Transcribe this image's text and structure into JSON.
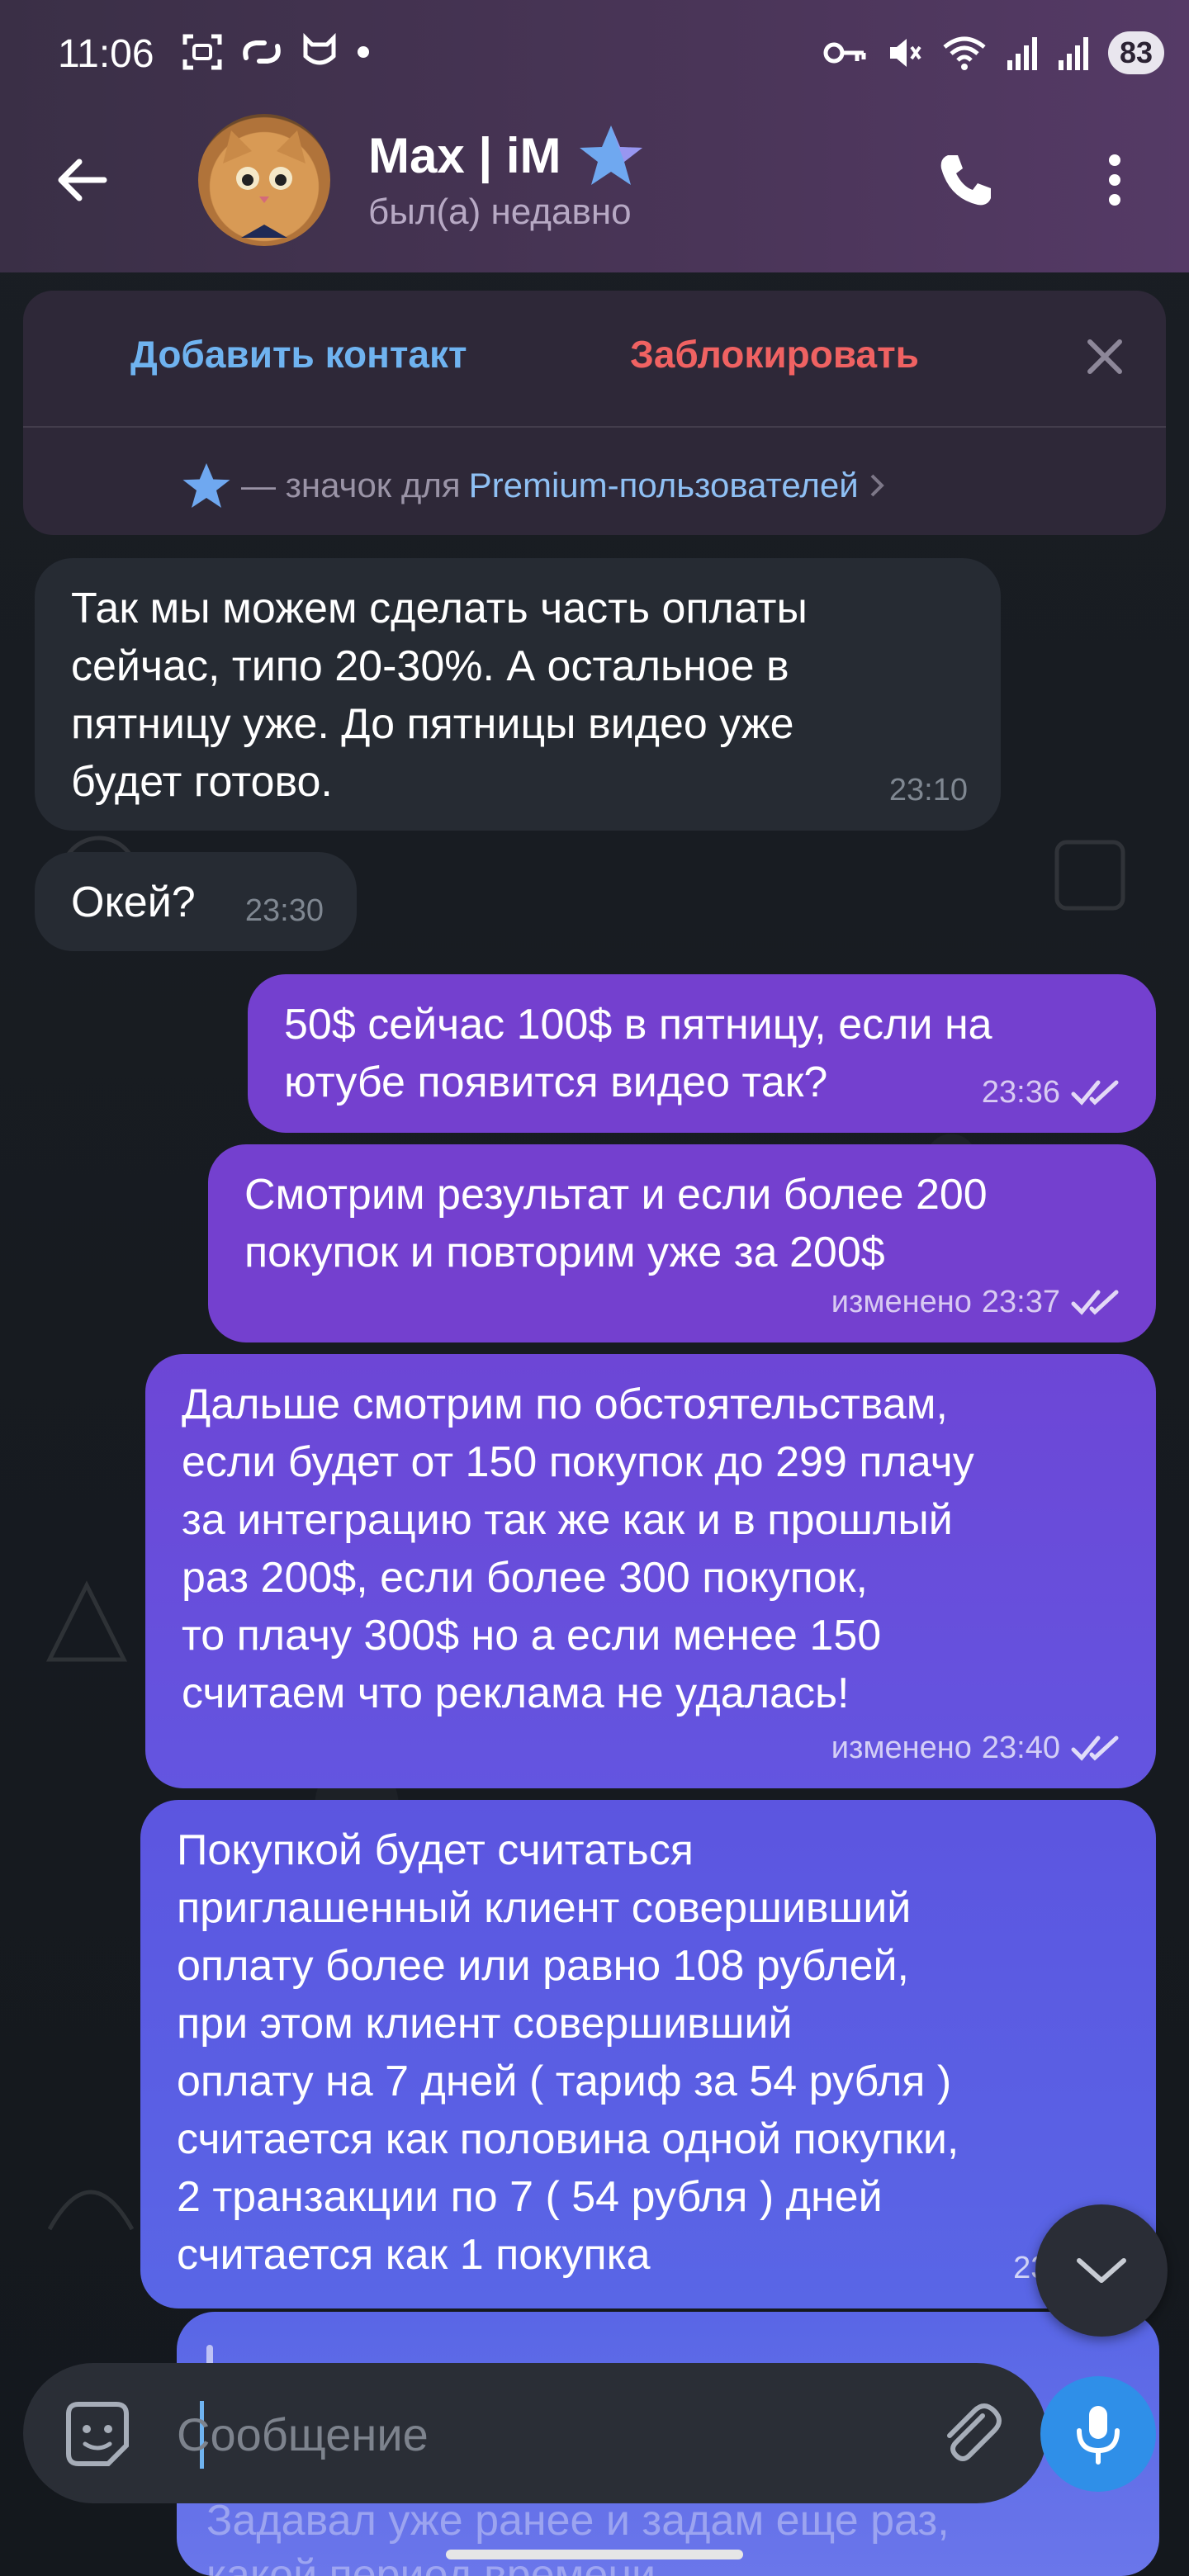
{
  "status_bar": {
    "time": "11:06",
    "battery": "83",
    "icons_left": [
      "screenshot-icon",
      "link-icon",
      "shield-cat-icon",
      "dot-icon"
    ],
    "icons_right": [
      "key-icon",
      "mute-icon",
      "wifi-icon",
      "signal-icon",
      "signal-icon"
    ]
  },
  "header": {
    "contact_name": "Max | iM",
    "contact_status": "был(а) недавно",
    "premium_star_color": "#6fa8f0"
  },
  "action_panel": {
    "add_contact": "Добавить контакт",
    "block": "Заблокировать",
    "premium_dash": "— значок для",
    "premium_link": "Premium-пользователей"
  },
  "messages": [
    {
      "direction": "in",
      "text": "Так мы можем сделать часть оплаты\nсейчас, типо 20-30%. А остальное в\nпятницу уже. До пятницы видео уже\nбудет готово.",
      "time": "23:10"
    },
    {
      "direction": "in",
      "text": "Окей?",
      "time": "23:30"
    },
    {
      "direction": "out",
      "text": "50$ сейчас 100$ в пятницу, если на\nютубе появится видео так?",
      "time": "23:36",
      "edited": ""
    },
    {
      "direction": "out",
      "text": "Смотрим результат и если более 200\nпокупок и повторим уже за 200$",
      "time": "23:37",
      "edited": "изменено"
    },
    {
      "direction": "out",
      "text": "Дальше смотрим по обстоятельствам,\nесли будет от 150 покупок до 299 плачу\nза интеграцию так же как и в прошлый\nраз 200$, если более 300 покупок,\nто плачу 300$ но а если менее 150\nсчитаем что реклама не удалась!",
      "time": "23:40",
      "edited": "изменено"
    },
    {
      "direction": "out",
      "text": "Покупкой будет считаться\nприглашенный клиент совершивший\nоплату более или равно 108 рублей,\nпри этом клиент совершивший\nоплату на 7 дней ( тариф за 54 рубля )\nсчитается как половина одной покупки,\n2 транзакции по 7 ( 54 рубля ) дней\nсчитается как 1 покупка",
      "time": "23:",
      "edited": ""
    }
  ],
  "partial_message": "Задавал уже ранее и задам еще раз,\nкакой период времени ...",
  "input": {
    "placeholder": "Сообщение"
  },
  "colors": {
    "header_bg": "#4a3558",
    "incoming_bubble": "#262b33",
    "outgoing_bubble": "#7440cf",
    "accent_blue": "#6fb3f0",
    "block_red": "#f06262",
    "mic_button": "#2f8fe8"
  }
}
